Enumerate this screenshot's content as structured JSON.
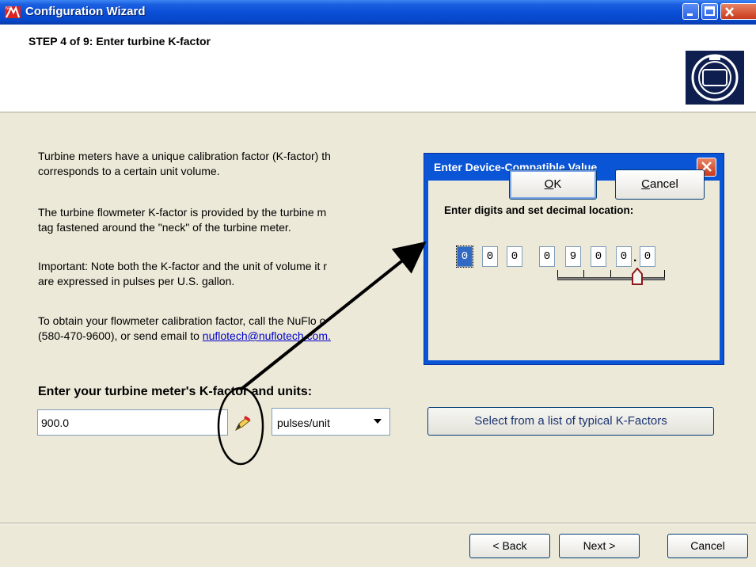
{
  "window": {
    "title": "Configuration Wizard",
    "app_icon_text": "NF",
    "controls": [
      "minimize-icon",
      "maximize-icon",
      "close-icon"
    ]
  },
  "header": {
    "step_title": "STEP 4 of 9:  Enter turbine K-factor"
  },
  "body": {
    "para1": "Turbine meters have a unique calibration factor (K-factor) th",
    "para1b": "corresponds to a certain unit volume.",
    "para2": "The turbine flowmeter K-factor is provided by the turbine m",
    "para2b": "tag fastened around the \"neck\" of the turbine meter.",
    "para3": "Important: Note both the K-factor and the unit of volume it r",
    "para3b": "are expressed in pulses per U.S. gallon.",
    "para4": "To obtain your flowmeter calibration factor, call the NuFlo o",
    "para4b_pre": "(580-470-9600), or send email to ",
    "para4b_link": "nuflotech@nuflotech.com."
  },
  "kfactor": {
    "heading": "Enter your turbine meter's K-factor and units:",
    "value": "900.0",
    "units_selected": "pulses/unit",
    "select_list_label": "Select from a list of typical K-Factors"
  },
  "nav": {
    "back_label": "< Back",
    "next_label": "Next >",
    "cancel_label": "Cancel"
  },
  "dialog": {
    "title": "Enter Device-Compatible Value",
    "prompt": "Enter digits and set decimal location:",
    "digits": [
      "0",
      "0",
      "0",
      "0",
      "9",
      "0",
      "0",
      "0"
    ],
    "decimal_mark": ".",
    "ok_label": "OK",
    "ok_accel": "O",
    "ok_rest": "K",
    "cancel_accel": "C",
    "cancel_rest": "ancel"
  },
  "colors": {
    "titlebar": "#0a4fd8",
    "dialog_frame": "#0a54d6",
    "link": "#0000cc",
    "panel": "#ece9d8"
  }
}
